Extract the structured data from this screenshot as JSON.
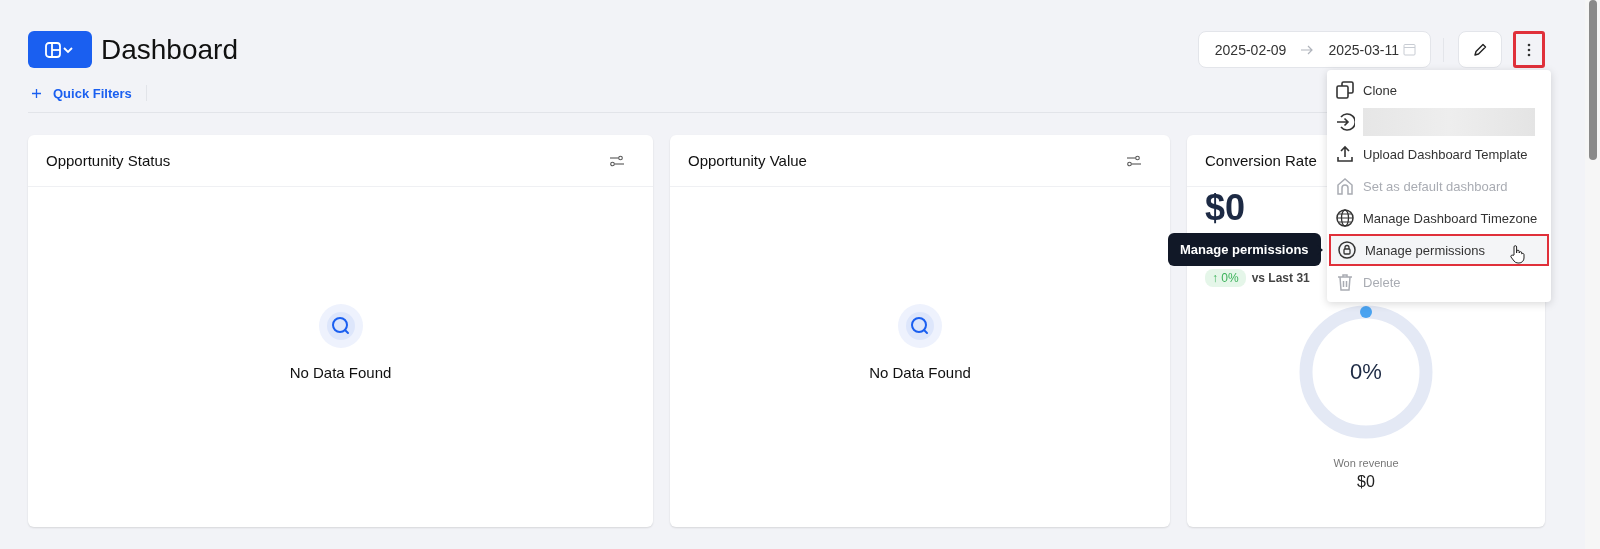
{
  "header": {
    "title": "Dashboard",
    "quick_filters": "Quick Filters",
    "date_start": "2025-02-09",
    "date_end": "2025-03-11",
    "more_button_annotated": true
  },
  "cards": [
    {
      "kind": "empty",
      "title": "Opportunity Status",
      "message": "No Data Found"
    },
    {
      "kind": "empty",
      "title": "Opportunity Value",
      "message": "No Data Found"
    },
    {
      "kind": "gauge",
      "title": "Conversion Rate",
      "value": "$0",
      "change": "↑ 0%",
      "comparison": "vs Last 31",
      "level": 0,
      "center_label": "0%",
      "caption": "Won revenue",
      "caption_value": "$0"
    }
  ],
  "menu": {
    "items": [
      {
        "kind": "clone",
        "label": "Clone",
        "disabled": false,
        "selected": false
      },
      {
        "kind": "import",
        "redacted": true,
        "disabled": false,
        "selected": false
      },
      {
        "kind": "upload",
        "label": "Upload Dashboard Template",
        "disabled": false,
        "selected": false
      },
      {
        "kind": "home",
        "label": "Set as default dashboard",
        "disabled": true,
        "selected": false
      },
      {
        "kind": "globe",
        "label": "Manage Dashboard Timezone",
        "disabled": false,
        "selected": false
      },
      {
        "kind": "lock",
        "label": "Manage permissions",
        "disabled": false,
        "selected": true
      },
      {
        "kind": "trash",
        "label": "Delete",
        "disabled": true,
        "selected": false
      }
    ]
  },
  "tooltip": "Manage permissions"
}
